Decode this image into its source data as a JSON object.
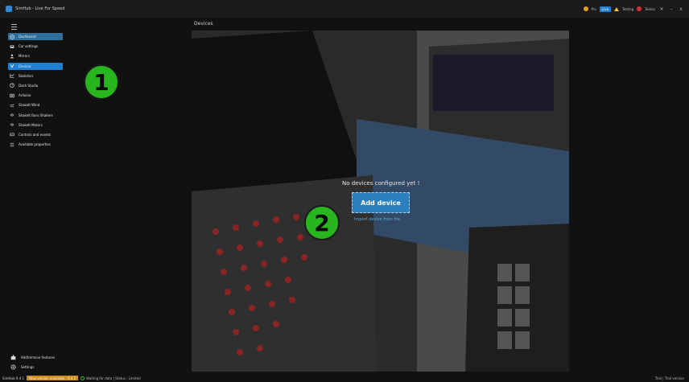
{
  "window": {
    "title": "SimHub - Live For Speed"
  },
  "titlebar": {
    "coins_label": "Pro",
    "live_label": "Live",
    "warnings_label": "Testing",
    "errors_label": "Testen",
    "settings_glyph": "✕",
    "minimize_glyph": "–",
    "close_glyph": "x"
  },
  "sidebar": {
    "items": [
      {
        "label": "Dashboard",
        "icon": "dashboard-icon"
      },
      {
        "label": "Car settings",
        "icon": "car-icon"
      },
      {
        "label": "Mirrors",
        "icon": "person-icon"
      },
      {
        "label": "Devices",
        "icon": "devices-icon"
      },
      {
        "label": "Statistics",
        "icon": "chart-icon"
      },
      {
        "label": "Dash Studio",
        "icon": "studio-icon"
      },
      {
        "label": "Arduino",
        "icon": "arduino-icon"
      },
      {
        "label": "ShakeIt Wind",
        "icon": "wind-icon"
      },
      {
        "label": "ShakeIt Bass Shakers",
        "icon": "bass-shaker-icon"
      },
      {
        "label": "ShakeIt Motors",
        "icon": "motor-icon"
      },
      {
        "label": "Controls and events",
        "icon": "controls-icon"
      },
      {
        "label": "Available properties",
        "icon": "list-icon"
      }
    ],
    "active_index": 3,
    "bottom": [
      {
        "label": "Add/remove features",
        "icon": "puzzle-icon"
      },
      {
        "label": "Settings",
        "icon": "gear-icon"
      }
    ]
  },
  "main": {
    "header": "Devices",
    "empty_message": "No devices configured yet !",
    "add_button": "Add device",
    "import_link": "Import device from file"
  },
  "markers": [
    "1",
    "2"
  ],
  "statusbar": {
    "version": "SimHub 9.4.1",
    "warning": "New version available : 9.4.2",
    "status": "Waiting for data | Status : Limited",
    "right": "Trial | Trial version"
  },
  "colors": {
    "accent": "#1f7fd0",
    "marker": "#28b61e",
    "warning": "#c98a1e"
  }
}
